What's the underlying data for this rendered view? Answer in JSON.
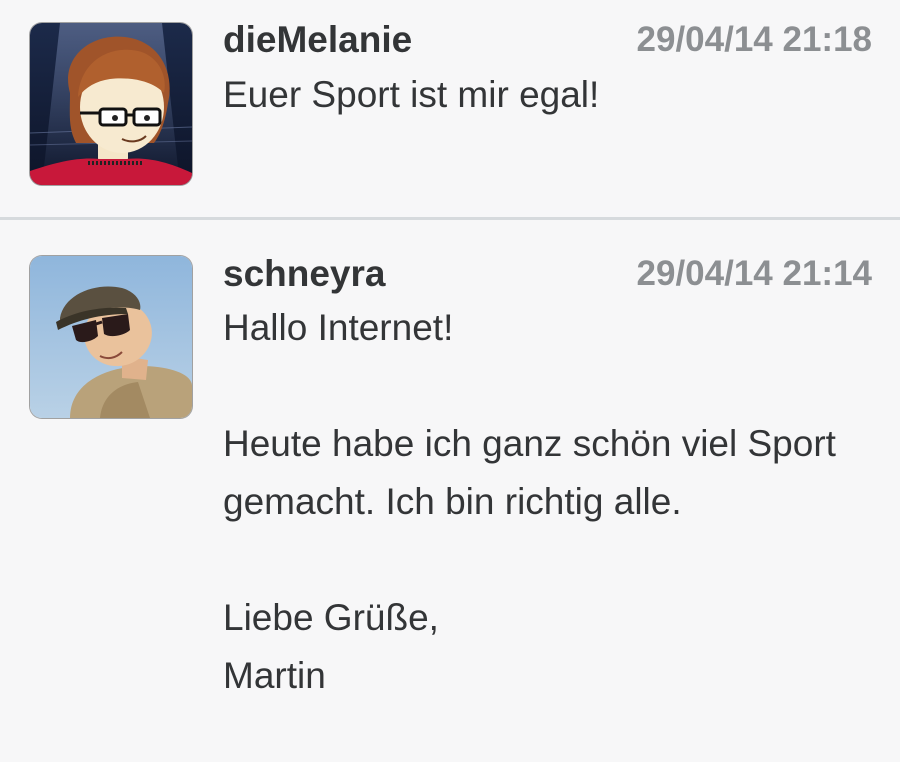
{
  "posts": [
    {
      "username": "dieMelanie",
      "timestamp": "29/04/14 21:18",
      "message": "Euer Sport ist mir egal!",
      "avatar_icon": "cartoon-woman-glasses-avatar"
    },
    {
      "username": "schneyra",
      "timestamp": "29/04/14 21:14",
      "message": "Hallo Internet!\n\nHeute habe ich ganz schön viel Sport gemacht. Ich bin richtig alle.\n\nLiebe Grüße,\nMartin",
      "avatar_icon": "man-cap-sunglasses-avatar"
    }
  ],
  "colors": {
    "background": "#f7f7f8",
    "divider": "#d6dadd",
    "text": "#333537",
    "timestamp": "#8c8f92"
  }
}
